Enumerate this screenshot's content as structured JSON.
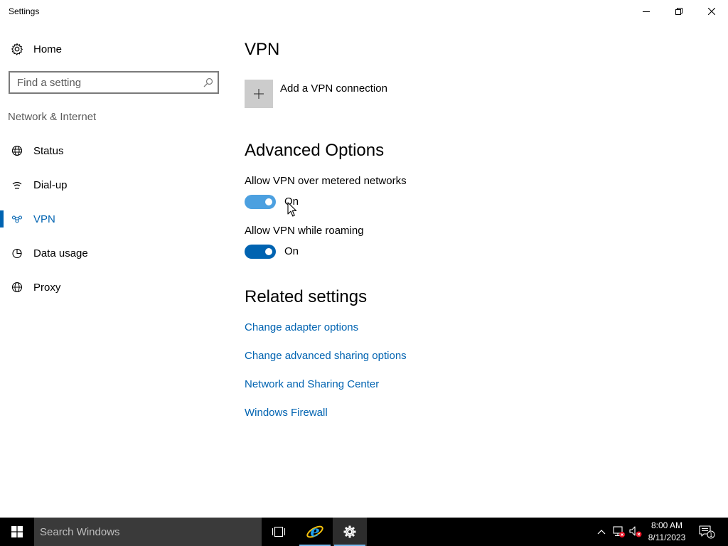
{
  "window": {
    "title": "Settings"
  },
  "sidebar": {
    "home_label": "Home",
    "search_placeholder": "Find a setting",
    "section_title": "Network & Internet",
    "items": [
      {
        "label": "Status",
        "icon": "globe-status-icon",
        "active": false
      },
      {
        "label": "Dial-up",
        "icon": "dial-up-icon",
        "active": false
      },
      {
        "label": "VPN",
        "icon": "vpn-icon",
        "active": true
      },
      {
        "label": "Data usage",
        "icon": "pie-chart-icon",
        "active": false
      },
      {
        "label": "Proxy",
        "icon": "globe-icon",
        "active": false
      }
    ]
  },
  "main": {
    "title": "VPN",
    "add_vpn_label": "Add a VPN connection",
    "advanced_title": "Advanced Options",
    "settings": [
      {
        "label": "Allow VPN over metered networks",
        "state": "On",
        "on": true,
        "hover": true
      },
      {
        "label": "Allow VPN while roaming",
        "state": "On",
        "on": true,
        "hover": false
      }
    ],
    "related_title": "Related settings",
    "links": [
      "Change adapter options",
      "Change advanced sharing options",
      "Network and Sharing Center",
      "Windows Firewall"
    ]
  },
  "taskbar": {
    "search_placeholder": "Search Windows",
    "time": "8:00 AM",
    "date": "8/11/2023",
    "notification_count": "1"
  },
  "colors": {
    "accent": "#0063b1",
    "toggle_on": "#0063b1",
    "toggle_hover": "#4ca0e0",
    "taskbar": "#000000"
  }
}
